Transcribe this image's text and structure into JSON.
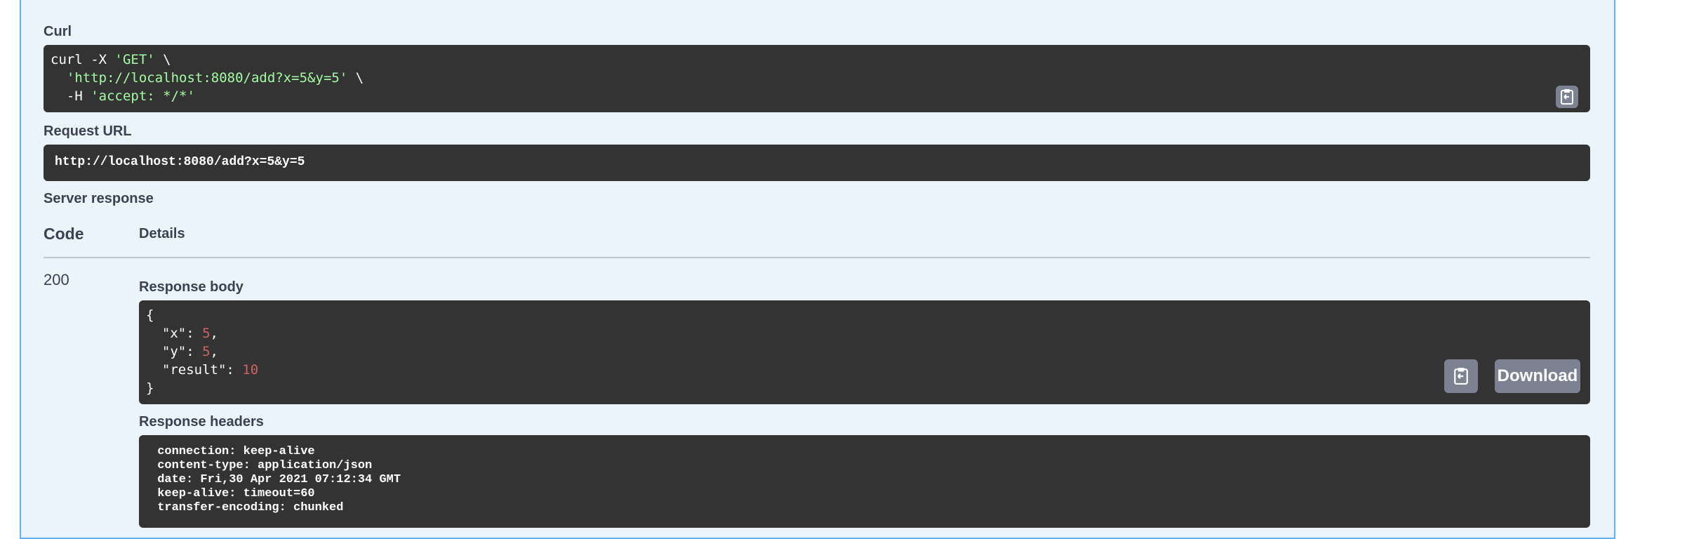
{
  "curl": {
    "label": "Curl",
    "lines": [
      {
        "pre": "curl -X ",
        "str": "'GET'",
        "post": " \\"
      },
      {
        "pre": "  ",
        "str": "'http://localhost:8080/add?x=5&y=5'",
        "post": " \\"
      },
      {
        "pre": "  -H ",
        "str": "'accept: */*'",
        "post": ""
      }
    ],
    "copy_icon": "clipboard-icon"
  },
  "request_url": {
    "label": "Request URL",
    "value": "http://localhost:8080/add?x=5&y=5"
  },
  "server_response": {
    "label": "Server response",
    "code_header": "Code",
    "details_header": "Details",
    "code": "200",
    "response_body": {
      "label": "Response body",
      "lines": [
        {
          "pre": "{",
          "num": "",
          "post": ""
        },
        {
          "pre": "  \"x\": ",
          "num": "5",
          "post": ","
        },
        {
          "pre": "  \"y\": ",
          "num": "5",
          "post": ","
        },
        {
          "pre": "  \"result\": ",
          "num": "10",
          "post": ""
        },
        {
          "pre": "}",
          "num": "",
          "post": ""
        }
      ],
      "copy_icon": "clipboard-icon",
      "download_label": "Download"
    },
    "response_headers": {
      "label": "Response headers",
      "lines": [
        " connection: keep-alive ",
        " content-type: application/json ",
        " date: Fri,30 Apr 2021 07:12:34 GMT ",
        " keep-alive: timeout=60 ",
        " transfer-encoding: chunked "
      ]
    }
  },
  "colors": {
    "panel_bg": "#ebf3fb",
    "panel_border": "#61affe",
    "code_bg": "#333333",
    "string": "#a2fca2",
    "number": "#d36363",
    "button_bg": "#7d8293"
  }
}
